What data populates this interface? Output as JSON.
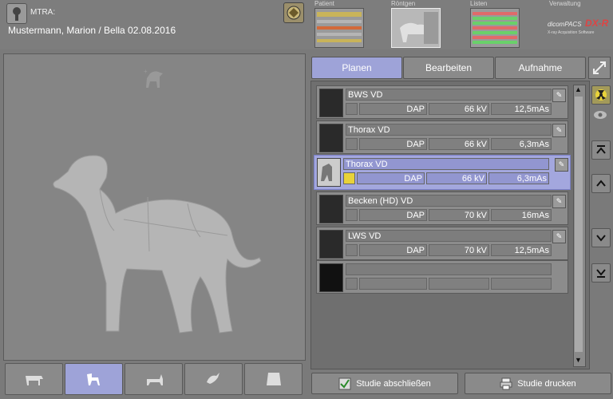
{
  "header": {
    "mtra_label": "MTRA:",
    "patient_line": "Mustermann, Marion / Bella  02.08.2016"
  },
  "nav": {
    "patient": "Patient",
    "roentgen": "Röntgen",
    "listen": "Listen",
    "verwaltung": "Verwaltung",
    "brand_dicom": "dicomPACS",
    "brand_dxr": "DX-R",
    "brand_sub": "X-ray Acquisition Software"
  },
  "tabs": {
    "planen": "Planen",
    "bearbeiten": "Bearbeiten",
    "aufnahme": "Aufnahme"
  },
  "exams": [
    {
      "name": "BWS VD",
      "dap": "DAP",
      "kv": "66 kV",
      "mas": "12,5mAs"
    },
    {
      "name": "Thorax VD",
      "dap": "DAP",
      "kv": "66 kV",
      "mas": "6,3mAs"
    },
    {
      "name": "Thorax VD",
      "dap": "DAP",
      "kv": "66 kV",
      "mas": "6,3mAs"
    },
    {
      "name": "Becken (HD) VD",
      "dap": "DAP",
      "kv": "70 kV",
      "mas": "16mAs"
    },
    {
      "name": "LWS VD",
      "dap": "DAP",
      "kv": "70 kV",
      "mas": "12,5mAs"
    },
    {
      "name": "",
      "dap": "",
      "kv": "",
      "mas": ""
    }
  ],
  "footer": {
    "close_study": "Studie abschließen",
    "print_study": "Studie drucken"
  },
  "colors": {
    "accent": "#9ea3d8",
    "background": "#7a7a7a",
    "radiation": "#e8d23a"
  }
}
